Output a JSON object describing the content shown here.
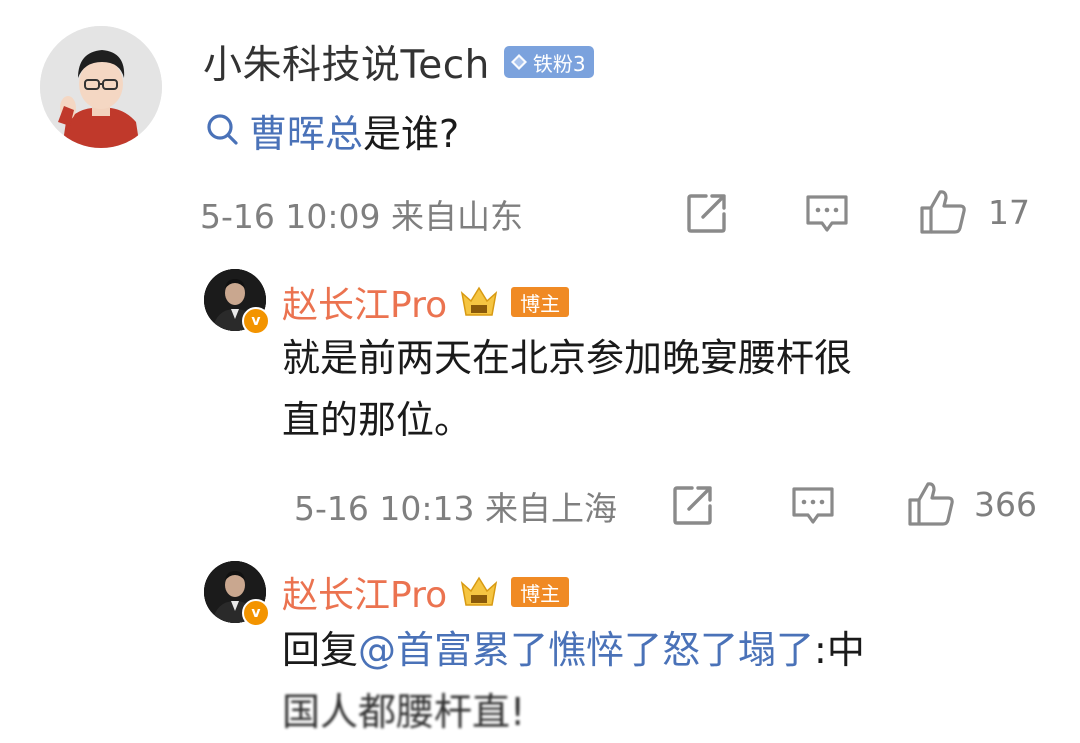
{
  "comment": {
    "author": "小朱科技说Tech",
    "fan_badge": "铁粉3",
    "topic_link": "曹晖总",
    "text_suffix": "是谁?",
    "time": "5-16 10:09 来自山东",
    "like_count": "17"
  },
  "reply1": {
    "author": "赵长江Pro",
    "blogger_badge": "博主",
    "text_line1": "就是前两天在北京参加晚宴腰杆很",
    "text_line2": "直的那位。",
    "time": "5-16 10:13 来自上海",
    "like_count": "366"
  },
  "reply2": {
    "author": "赵长江Pro",
    "blogger_badge": "博主",
    "reply_prefix": "回复",
    "mention": "@首富累了憔悴了怒了塌了",
    "text_after_mention": ":中",
    "text_line2": "国人都腰杆直!"
  },
  "icons": {
    "verified": "v",
    "search": "search-icon",
    "share": "share-icon",
    "comment": "comment-icon",
    "like": "thumbs-up-icon"
  },
  "colors": {
    "link": "#4a72b8",
    "reply_name": "#eb7350",
    "meta": "#7f7f7f",
    "fan_badge": "#7ba2dd",
    "blogger_badge": "#f08a24"
  }
}
